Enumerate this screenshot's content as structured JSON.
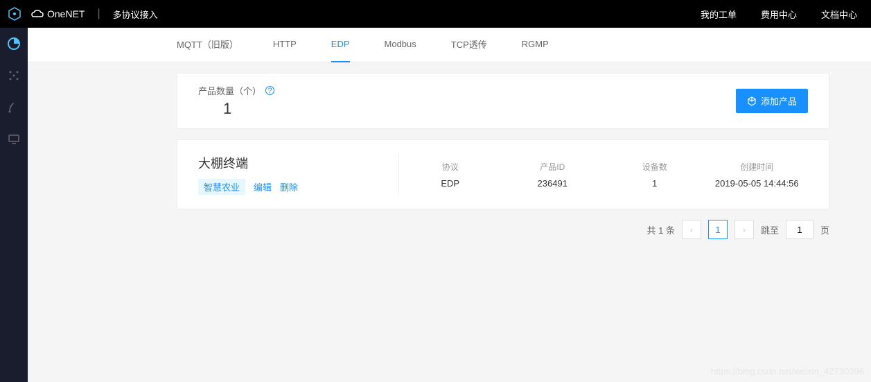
{
  "header": {
    "brand": "OneNET",
    "title": "多协议接入",
    "links": [
      "我的工单",
      "费用中心",
      "文档中心"
    ]
  },
  "tabs": [
    {
      "label": "MQTT（旧版）",
      "active": false
    },
    {
      "label": "HTTP",
      "active": false
    },
    {
      "label": "EDP",
      "active": true
    },
    {
      "label": "Modbus",
      "active": false
    },
    {
      "label": "TCP透传",
      "active": false
    },
    {
      "label": "RGMP",
      "active": false
    }
  ],
  "stats": {
    "label": "产品数量（个）",
    "value": "1",
    "add_button": "添加产品"
  },
  "product": {
    "name": "大棚终端",
    "tag": "智慧农业",
    "edit": "编辑",
    "delete": "删除",
    "meta": [
      {
        "label": "协议",
        "value": "EDP"
      },
      {
        "label": "产品ID",
        "value": "236491"
      },
      {
        "label": "设备数",
        "value": "1"
      },
      {
        "label": "创建时间",
        "value": "2019-05-05 14:44:56"
      }
    ]
  },
  "pagination": {
    "total_label": "共 1 条",
    "current": "1",
    "jump_label": "跳至",
    "jump_value": "1",
    "page_suffix": "页"
  },
  "watermark": "https://blog.csdn.net/weixin_42730396"
}
